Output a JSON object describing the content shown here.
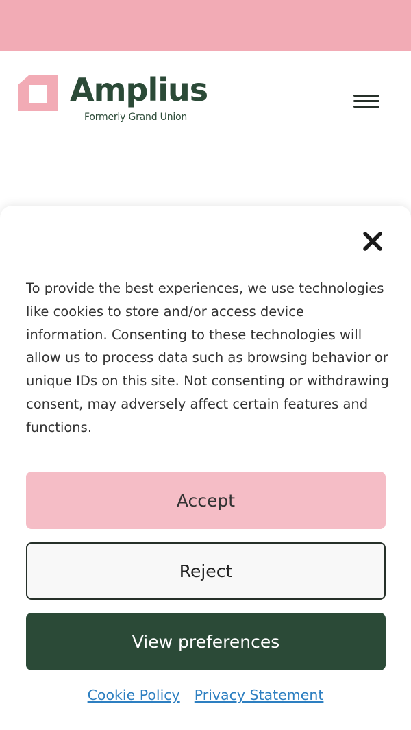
{
  "brand": {
    "name": "Amplius",
    "tagline": "Formerly Grand Union",
    "logo_icon": "amplius-logo-mark",
    "colors": {
      "pink": "#f2abb5",
      "accent_pink": "#f5bdc6",
      "dark_green": "#2b4a37",
      "link_blue": "#2d7fc1"
    }
  },
  "header": {
    "menu_icon": "hamburger-menu-icon"
  },
  "cookie_banner": {
    "close_icon": "close-icon",
    "message": "To provide the best experiences, we use technologies like cookies to store and/or access device information. Consenting to these technologies will allow us to process data such as browsing behavior or unique IDs on this site. Not consenting or withdrawing consent, may adversely affect certain features and functions.",
    "accept_label": "Accept",
    "reject_label": "Reject",
    "preferences_label": "View preferences",
    "links": {
      "cookie_policy": "Cookie Policy",
      "privacy_statement": "Privacy Statement"
    }
  }
}
